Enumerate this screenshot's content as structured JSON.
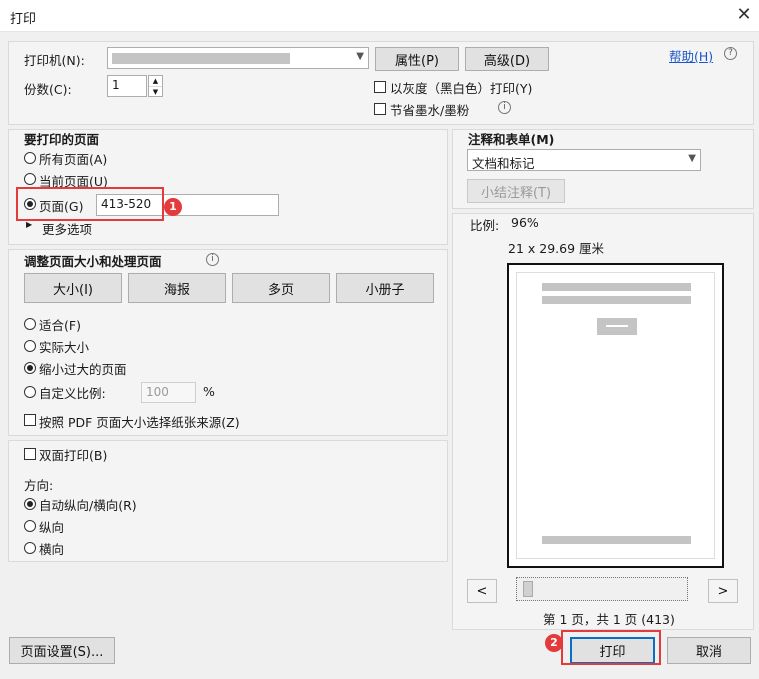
{
  "window": {
    "title": "打印",
    "close_glyph": "✕"
  },
  "printer": {
    "printer_label": "打印机(N):",
    "properties_button": "属性(P)",
    "advanced_button": "高级(D)",
    "help_link": "帮助(H)",
    "copies_label": "份数(C):",
    "copies_value": "1",
    "grayscale_label": "以灰度（黑白色）打印(Y)",
    "save_ink_label": "节省墨水/墨粉"
  },
  "pages_to_print": {
    "heading": "要打印的页面",
    "all_pages": "所有页面(A)",
    "current_page": "当前页面(U)",
    "pages": "页面(G)",
    "pages_value": "413-520",
    "more_options": "更多选项",
    "badge_1": "1"
  },
  "sizing": {
    "heading": "调整页面大小和处理页面",
    "size_button": "大小(I)",
    "poster_button": "海报",
    "multiple_button": "多页",
    "booklet_button": "小册子",
    "fit": "适合(F)",
    "actual_size": "实际大小",
    "shrink": "缩小过大的页面",
    "custom_scale": "自定义比例:",
    "custom_scale_value": "100",
    "percent": "%",
    "pdf_page_size": "按照 PDF 页面大小选择纸张来源(Z)"
  },
  "duplex": {
    "duplex_label": "双面打印(B)",
    "orientation_label": "方向:",
    "auto": "自动纵向/横向(R)",
    "portrait": "纵向",
    "landscape": "横向"
  },
  "comments": {
    "heading": "注释和表单(M)",
    "selected": "文档和标记",
    "summarize_button": "小结注释(T)"
  },
  "preview": {
    "scale_label": "比例:",
    "scale_value": "96%",
    "paper_size": "21 x 29.69 厘米",
    "prev_button": "<",
    "next_button": ">",
    "page_info": "第 1 页，共 1 页 (413)"
  },
  "footer": {
    "page_setup_button": "页面设置(S)...",
    "print_button": "打印",
    "cancel_button": "取消",
    "badge_2": "2"
  }
}
